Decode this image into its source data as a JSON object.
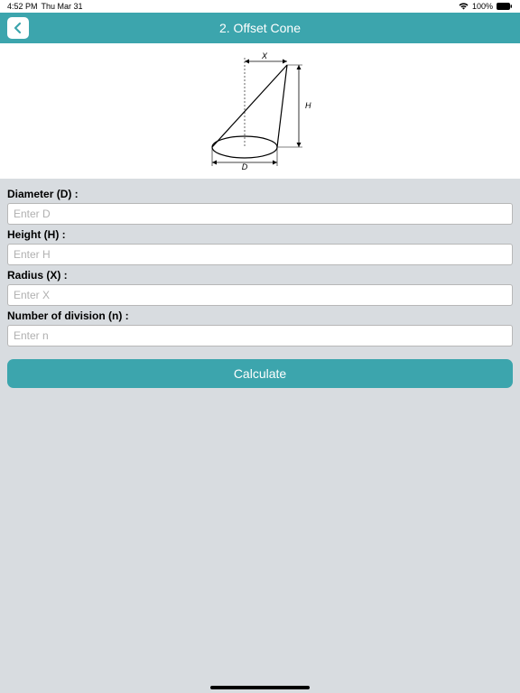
{
  "statusbar": {
    "time": "4:52 PM",
    "date": "Thu Mar 31",
    "battery": "100%"
  },
  "navbar": {
    "title": "2. Offset Cone"
  },
  "diagram": {
    "label_x": "X",
    "label_h": "H",
    "label_d": "D"
  },
  "fields": [
    {
      "label": "Diameter (D) :",
      "placeholder": "Enter D"
    },
    {
      "label": "Height (H) :",
      "placeholder": "Enter H"
    },
    {
      "label": "Radius (X) :",
      "placeholder": "Enter X"
    },
    {
      "label": "Number of division (n) :",
      "placeholder": "Enter n"
    }
  ],
  "buttons": {
    "calculate": "Calculate"
  }
}
